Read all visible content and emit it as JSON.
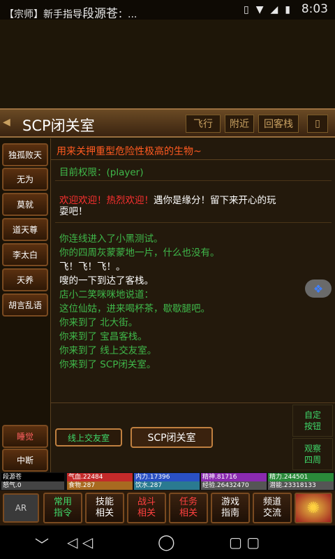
{
  "statusbar": {
    "notif_prefix": "【宗师】新手指导",
    "notif_name": "段源苍",
    "notif_suffix": "：...",
    "time": "8:03"
  },
  "header": {
    "title": "SCP闭关室",
    "buttons": [
      "飞行",
      "附近",
      "回客栈"
    ],
    "menu": "▯"
  },
  "sidebar": {
    "items": [
      "独孤败天",
      "无为",
      "莫就",
      "道天尊",
      "李太白",
      "天养",
      "胡言乱语"
    ],
    "sleep": "睡觉",
    "interrupt": "中断"
  },
  "content": {
    "desc": "用来关押重型危险性极高的生物~",
    "perm": "目前权限：(player)",
    "welcome_red": "欢迎欢迎！热烈欢迎！",
    "welcome_white": "遇你是缘分！留下来开心的玩",
    "welcome_white2": "耍吧！",
    "log": [
      {
        "text": "你连线进入了小黑测试。",
        "color": "#3fb84a"
      },
      {
        "text": "你的四周灰蒙蒙地一片，什么也没有。",
        "color": "#3fb84a"
      },
      {
        "text": "飞！飞！飞！。",
        "color": "#ffffff"
      },
      {
        "text": "嗖的一下到达了客栈。",
        "color": "#ffffff"
      },
      {
        "text": "店小二笑咪咪地说道：",
        "color": "#3fb84a"
      },
      {
        "text": "这位仙姑，进来喝杯茶，歇歇腿吧。",
        "color": "#3fb84a"
      },
      {
        "text": "你来到了 北大街。",
        "color": "#3fb84a"
      },
      {
        "text": "你来到了 宝昌客栈。",
        "color": "#3fb84a"
      },
      {
        "text": "你来到了 线上交友室。",
        "color": "#3fb84a"
      },
      {
        "text": "你来到了 SCP闭关室。",
        "color": "#3fb84a"
      }
    ]
  },
  "bottom": {
    "exit1": "线上交友室",
    "exit2": "SCP闭关室",
    "side1a": "自定",
    "side1b": "按钮",
    "side2a": "观察",
    "side2b": "四周"
  },
  "stats": {
    "row1": [
      "段源苍",
      "气血.22484",
      "内力.17396",
      "精神.81716",
      "精力.244501"
    ],
    "row2": [
      "怒气.0",
      "食物.287",
      "饮水.287",
      "经验.26432470",
      "潜能.23318133"
    ]
  },
  "tabs": [
    {
      "a": "常用",
      "b": "指令",
      "color": "#3fd86a"
    },
    {
      "a": "技能",
      "b": "相关",
      "color": "#ffffff"
    },
    {
      "a": "战斗",
      "b": "相关",
      "color": "#ff4040"
    },
    {
      "a": "任务",
      "b": "相关",
      "color": "#ff4040"
    },
    {
      "a": "游戏",
      "b": "指南",
      "color": "#ffffff"
    },
    {
      "a": "频道",
      "b": "交流",
      "color": "#ffffff"
    }
  ],
  "colors": {
    "green": "#3fb84a",
    "red": "#ff3030",
    "orange_title": "#ff5a20"
  }
}
